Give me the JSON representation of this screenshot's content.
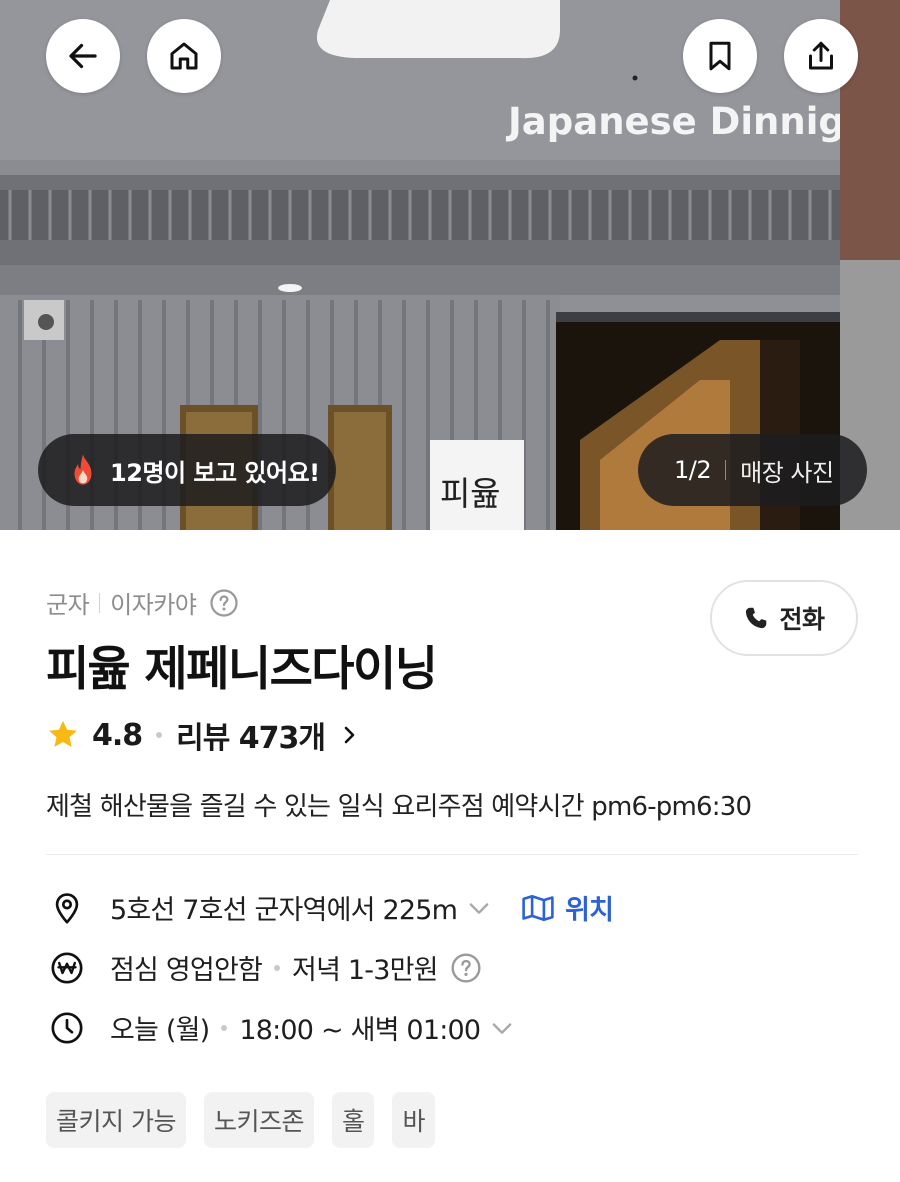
{
  "hero": {
    "sign_text": "Japanese Dinnig",
    "door_sign_text": "피윮",
    "back_icon": "arrow-left-icon",
    "home_icon": "home-icon",
    "bookmark_icon": "bookmark-icon",
    "share_icon": "share-icon",
    "viewing_text": "12명이 보고 있어요!",
    "photo_counter": "1/2",
    "photo_category": "매장 사진"
  },
  "place": {
    "region": "군자",
    "category": "이자카야",
    "call_label": "전화",
    "name": "피윮 제페니즈다이닝",
    "rating": "4.8",
    "reviews_label": "리뷰 473개",
    "description": "제철 해산물을 즐길 수 있는 일식 요리주점  예약시간 pm6-pm6:30"
  },
  "details": {
    "location_text": "5호선 7호선 군자역에서 225m",
    "map_label": "위치",
    "lunch_text": "점심 영업안함",
    "dinner_text": "저녁 1-3만원",
    "hours_day": "오늘 (월)",
    "hours_time": "18:00 ~ 새벽 01:00"
  },
  "tags": [
    "콜키지 가능",
    "노키즈존",
    "홀",
    "바"
  ],
  "colors": {
    "accent_blue": "#2b63d6",
    "star_yellow": "#f9b914",
    "fire_red": "#f04b36",
    "pill_dark": "#1c1c1e"
  }
}
